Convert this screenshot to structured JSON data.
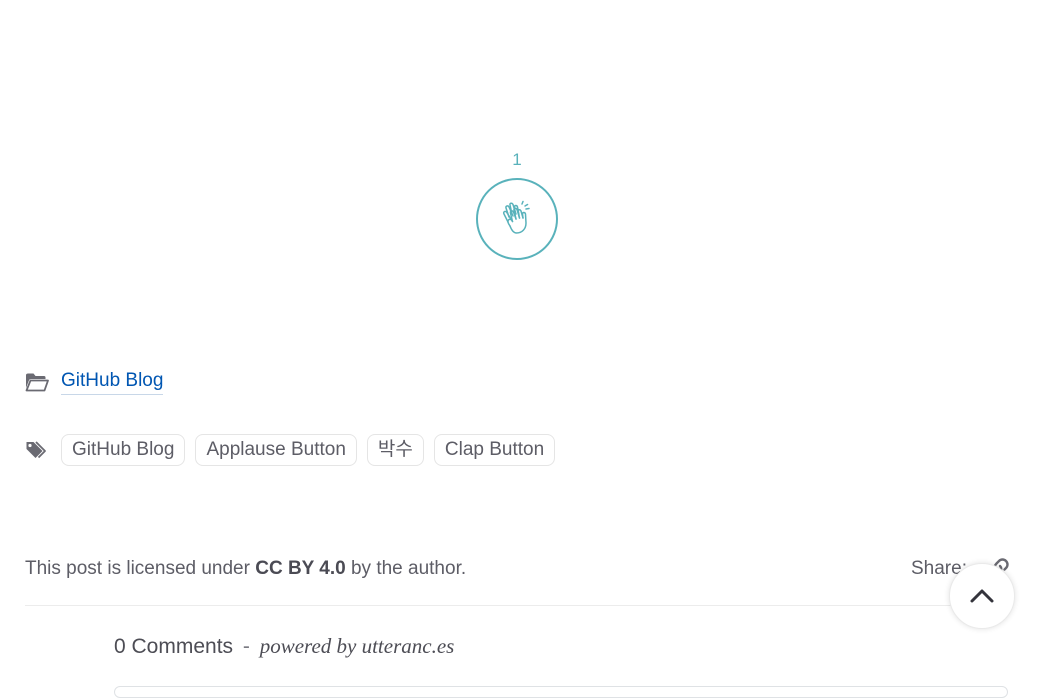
{
  "applause": {
    "count": "1",
    "accent_color": "#59b2bb",
    "icon": "clapping-hands-icon"
  },
  "category": {
    "icon": "folder-open-icon",
    "label": "GitHub Blog"
  },
  "tags": {
    "icon": "tags-icon",
    "items": [
      "GitHub Blog",
      "Applause Button",
      "박수",
      "Clap Button"
    ]
  },
  "license": {
    "prefix": "This post is licensed under",
    "license_name": "CC BY 4.0",
    "suffix": "by the author."
  },
  "share": {
    "label": "Share",
    "icon": "link-icon"
  },
  "back_to_top": {
    "icon": "chevron-up-icon"
  },
  "comments": {
    "count_label": "0 Comments",
    "separator": "-",
    "powered_by": "powered by utteranc.es"
  },
  "colors": {
    "link": "#0056b2",
    "text": "#5d5d66"
  }
}
